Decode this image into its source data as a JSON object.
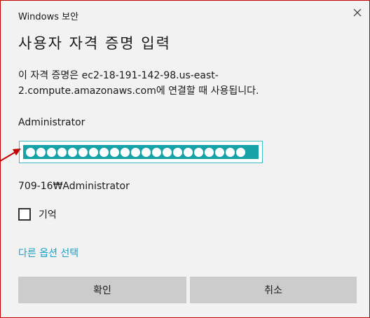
{
  "window": {
    "title": "Windows 보안",
    "close_glyph": "✕",
    "border_color": "#c00000"
  },
  "dialog": {
    "heading": "사용자 자격 증명 입력",
    "description": "이 자격 증명은 ec2-18-191-142-98.us-east-2.compute.amazonaws.com에 연결할 때 사용됩니다.",
    "username": "Administrator",
    "password": {
      "masked_length": 21,
      "selection_color": "#17a2a8",
      "border_color": "#3dbcc2"
    },
    "domain_user": "709-16₩Administrator",
    "remember": {
      "label": "기억",
      "checked": false
    },
    "more_options_label": "다른 옵션 선택",
    "link_color": "#1a9fc7",
    "ok_label": "확인",
    "cancel_label": "취소"
  },
  "annotation": {
    "arrow_color": "#c00000",
    "icon": "arrow-right-icon"
  }
}
